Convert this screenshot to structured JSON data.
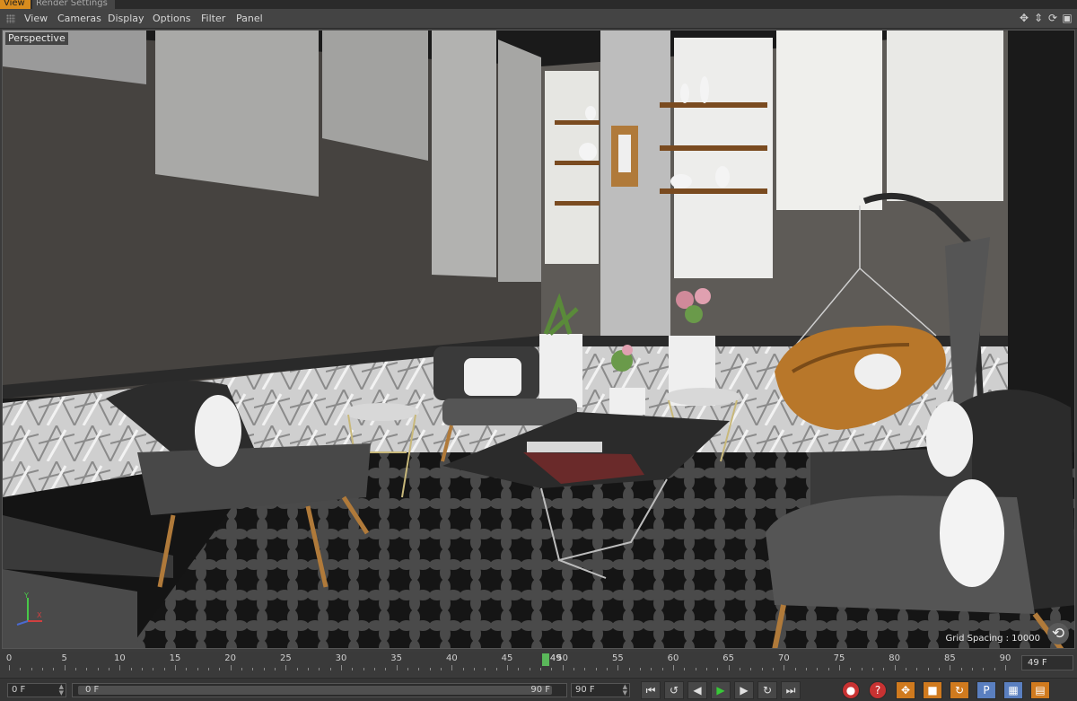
{
  "tabs": [
    {
      "label": "View",
      "active": true
    },
    {
      "label": "Render Settings",
      "active": false
    }
  ],
  "menu": [
    "View",
    "Cameras",
    "Display",
    "Options",
    "Filter",
    "Panel"
  ],
  "nav_icons": [
    "move-icon",
    "dolly-icon",
    "rotate-icon",
    "maximize-icon"
  ],
  "viewport": {
    "label": "Perspective",
    "grid_spacing": "Grid Spacing : 10000",
    "axis": {
      "y": "Y",
      "x": "X"
    }
  },
  "timeline": {
    "ticks": [
      "0",
      "5",
      "10",
      "15",
      "20",
      "25",
      "30",
      "35",
      "40",
      "45",
      "50",
      "55",
      "60",
      "65",
      "70",
      "75",
      "80",
      "85",
      "90"
    ],
    "current_frame": "49",
    "current_fraction": 0.544,
    "frame_display": "49 F"
  },
  "transport": {
    "start_frame": "0 F",
    "range_start": "0 F",
    "range_end": "90 F",
    "end_frame": "90 F",
    "buttons": [
      {
        "name": "go-to-start-icon",
        "glyph": "⏮"
      },
      {
        "name": "prev-key-icon",
        "glyph": "↺"
      },
      {
        "name": "prev-frame-icon",
        "glyph": "◀"
      },
      {
        "name": "play-icon",
        "glyph": "▶"
      },
      {
        "name": "next-frame-icon",
        "glyph": "▶"
      },
      {
        "name": "next-key-icon",
        "glyph": "↻"
      },
      {
        "name": "go-to-end-icon",
        "glyph": "⏭"
      }
    ],
    "tools": [
      {
        "name": "record-icon",
        "glyph": "●"
      },
      {
        "name": "autokey-icon",
        "glyph": "?"
      },
      {
        "name": "position-key-icon",
        "glyph": "✥"
      },
      {
        "name": "scale-key-icon",
        "glyph": "■"
      },
      {
        "name": "rotation-key-icon",
        "glyph": "↻"
      },
      {
        "name": "parameter-key-icon",
        "glyph": "P"
      },
      {
        "name": "pla-key-icon",
        "glyph": "▦"
      },
      {
        "name": "filmstrip-icon",
        "glyph": "▤"
      }
    ]
  }
}
